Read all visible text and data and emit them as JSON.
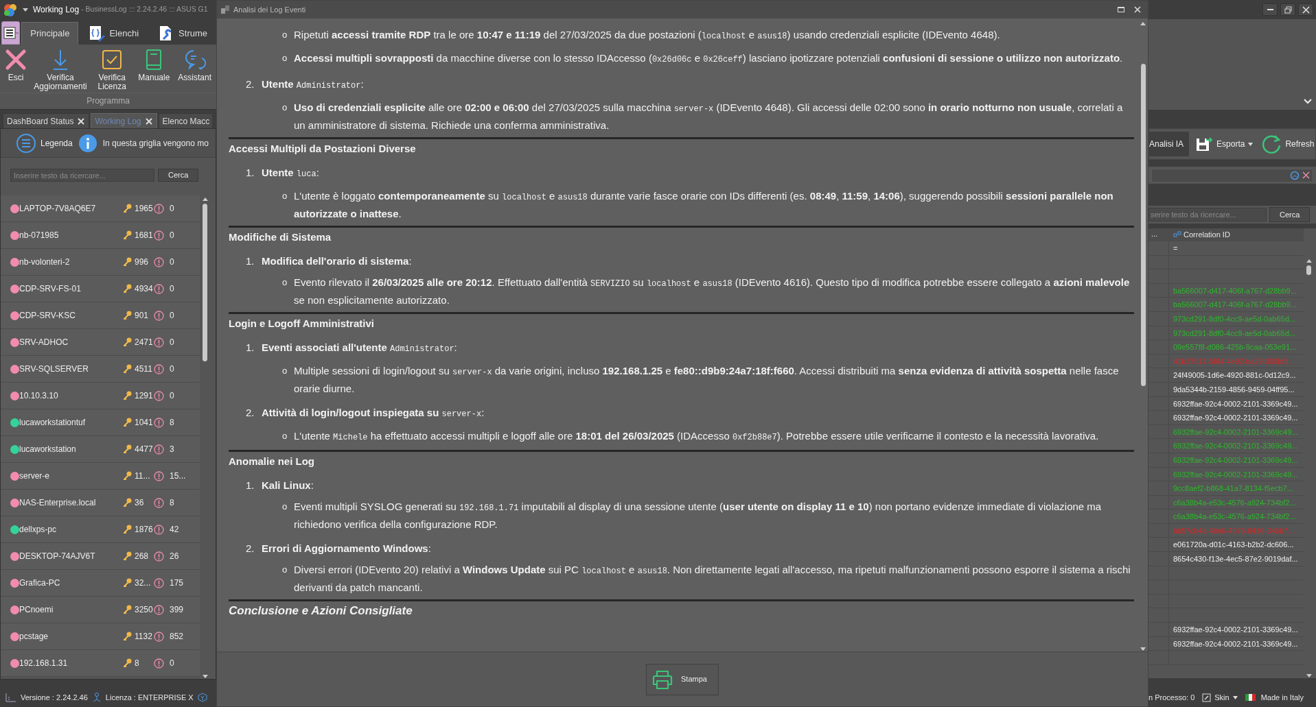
{
  "app": {
    "title": "Working Log",
    "subtitle": "- BusinessLog ::: 2.24.2.46 ::: ASUS G1"
  },
  "ribbon_tabs": [
    {
      "label": "Principale",
      "selected": true
    },
    {
      "label": "Elenchi",
      "selected": false
    },
    {
      "label": "Strume",
      "selected": false
    }
  ],
  "ribbon_group": {
    "label": "Programma",
    "buttons": [
      {
        "label": "Esci"
      },
      {
        "label": "Verifica Aggiornamenti"
      },
      {
        "label": "Verifica Licenza"
      },
      {
        "label": "Manuale"
      },
      {
        "label": "Assistant"
      }
    ]
  },
  "doc_tabs": [
    {
      "label": "DashBoard Status",
      "selected": false,
      "closable": true
    },
    {
      "label": "Working Log",
      "selected": true,
      "closable": true
    },
    {
      "label": "Elenco Macc",
      "selected": false,
      "closable": false
    }
  ],
  "toolbar": {
    "legend": "Legenda",
    "info": "In questa griglia vengono mo"
  },
  "search": {
    "placeholder": "Inserire testo da ricercare...",
    "button": "Cerca"
  },
  "machines": [
    {
      "name": "LAPTOP-7V8AQ6E7",
      "color": "#f28cae",
      "keys": "1965",
      "alerts": "0"
    },
    {
      "name": "nb-071985",
      "color": "#f28cae",
      "keys": "1681",
      "alerts": "0"
    },
    {
      "name": "nb-volonteri-2",
      "color": "#f28cae",
      "keys": "996",
      "alerts": "0"
    },
    {
      "name": "CDP-SRV-FS-01",
      "color": "#f28cae",
      "keys": "4934",
      "alerts": "0"
    },
    {
      "name": "CDP-SRV-KSC",
      "color": "#f28cae",
      "keys": "901",
      "alerts": "0"
    },
    {
      "name": "SRV-ADHOC",
      "color": "#f28cae",
      "keys": "2471",
      "alerts": "0"
    },
    {
      "name": "SRV-SQLSERVER",
      "color": "#f28cae",
      "keys": "4511",
      "alerts": "0"
    },
    {
      "name": "10.10.3.10",
      "color": "#f28cae",
      "keys": "1291",
      "alerts": "0"
    },
    {
      "name": "lucaworkstationtuf",
      "color": "#34d399",
      "keys": "1041",
      "alerts": "8"
    },
    {
      "name": "lucaworkstation",
      "color": "#34d399",
      "keys": "4477",
      "alerts": "3"
    },
    {
      "name": "server-e",
      "color": "#f28cae",
      "keys": "11...",
      "alerts": "15..."
    },
    {
      "name": "NAS-Enterprise.local",
      "color": "#f28cae",
      "keys": "36",
      "alerts": "8"
    },
    {
      "name": "dellxps-pc",
      "color": "#34d399",
      "keys": "1876",
      "alerts": "42"
    },
    {
      "name": "DESKTOP-74AJV6T",
      "color": "#f28cae",
      "keys": "268",
      "alerts": "26"
    },
    {
      "name": "Grafica-PC",
      "color": "#f28cae",
      "keys": "32...",
      "alerts": "175"
    },
    {
      "name": "PCnoemi",
      "color": "#f28cae",
      "keys": "3250",
      "alerts": "399"
    },
    {
      "name": "pcstage",
      "color": "#f28cae",
      "keys": "1132",
      "alerts": "852"
    },
    {
      "name": "192.168.1.31",
      "color": "#f28cae",
      "keys": "8",
      "alerts": "0"
    }
  ],
  "status_left": [
    "Versione : 2.24.2.46",
    "Licenza : ENTERPRISE X"
  ],
  "dialog": {
    "title": "Analisi dei Log Eventi",
    "print_button": "Stampa",
    "blocks": [
      {
        "kind": "bullet",
        "marker": "o",
        "segments": [
          {
            "kind": "text",
            "text": "Ripetuti **accessi tramite RDP** tra le ore **10:47 e 11:19** del 27/03/2025 da due postazioni ("
          },
          {
            "kind": "code",
            "text": "localhost"
          },
          {
            "kind": "text",
            "text": " e "
          },
          {
            "kind": "code",
            "text": "asus18"
          },
          {
            "kind": "text",
            "text": ") usando credenziali esplicite (IDEvento 4648)."
          }
        ]
      },
      {
        "kind": "bullet",
        "marker": "o",
        "segments": [
          {
            "kind": "text",
            "text": "**Accessi multipli sovrapposti** da macchine diverse con lo stesso IDAccesso ("
          },
          {
            "kind": "code",
            "text": "0x26d06c"
          },
          {
            "kind": "text",
            "text": " e "
          },
          {
            "kind": "code",
            "text": "0x26ceff"
          },
          {
            "kind": "text",
            "text": ") lasciano ipotizzare potenziali **confusioni di sessione o utilizzo non autorizzato**."
          }
        ]
      },
      {
        "kind": "item",
        "marker": "2.",
        "segments": [
          {
            "kind": "text",
            "text": "**Utente** "
          },
          {
            "kind": "code",
            "text": "Administrator"
          },
          {
            "kind": "text",
            "text": ":"
          }
        ]
      },
      {
        "kind": "bullet",
        "marker": "o",
        "segments": [
          {
            "kind": "text",
            "text": "**Uso di credenziali esplicite** alle ore **02:00 e 06:00** del 27/03/2025 sulla macchina "
          },
          {
            "kind": "code",
            "text": "server-x"
          },
          {
            "kind": "text",
            "text": " (IDEvento 4648). Gli accessi delle 02:00 sono **in orario notturno non usuale**, correlati a un amministratore di sistema. Richiede una conferma amministrativa."
          }
        ]
      },
      {
        "kind": "rule"
      },
      {
        "kind": "heading",
        "text": "Accessi Multipli da Postazioni Diverse"
      },
      {
        "kind": "item",
        "marker": "1.",
        "segments": [
          {
            "kind": "text",
            "text": "**Utente** "
          },
          {
            "kind": "code",
            "text": "luca"
          },
          {
            "kind": "text",
            "text": ":"
          }
        ]
      },
      {
        "kind": "bullet",
        "marker": "o",
        "segments": [
          {
            "kind": "text",
            "text": "L'utente è loggato **contemporaneamente** su "
          },
          {
            "kind": "code",
            "text": "localhost"
          },
          {
            "kind": "text",
            "text": " e "
          },
          {
            "kind": "code",
            "text": "asus18"
          },
          {
            "kind": "text",
            "text": " durante varie fasce orarie con IDs differenti (es. **08:49**, **11:59**, **14:06**), suggerendo possibili **sessioni parallele non autorizzate o inattese**."
          }
        ]
      },
      {
        "kind": "rule"
      },
      {
        "kind": "heading",
        "text": "Modifiche di Sistema"
      },
      {
        "kind": "item",
        "marker": "1.",
        "segments": [
          {
            "kind": "text",
            "text": "**Modifica dell'orario di sistema**:"
          }
        ]
      },
      {
        "kind": "bullet",
        "marker": "o",
        "segments": [
          {
            "kind": "text",
            "text": "Evento rilevato il **26/03/2025 alle ore 20:12**. Effettuato dall'entità "
          },
          {
            "kind": "code",
            "text": "SERVIZIO"
          },
          {
            "kind": "text",
            "text": " su "
          },
          {
            "kind": "code",
            "text": "localhost"
          },
          {
            "kind": "text",
            "text": " e "
          },
          {
            "kind": "code",
            "text": "asus18"
          },
          {
            "kind": "text",
            "text": " (IDEvento 4616). Questo tipo di modifica potrebbe essere collegato a **azioni malevole** se non esplicitamente autorizzato."
          }
        ]
      },
      {
        "kind": "rule"
      },
      {
        "kind": "heading",
        "text": "Login e Logoff Amministrativi"
      },
      {
        "kind": "item",
        "marker": "1.",
        "segments": [
          {
            "kind": "text",
            "text": "**Eventi associati all'utente** "
          },
          {
            "kind": "code",
            "text": "Administrator"
          },
          {
            "kind": "text",
            "text": ":"
          }
        ]
      },
      {
        "kind": "bullet",
        "marker": "o",
        "segments": [
          {
            "kind": "text",
            "text": "Multiple sessioni di login/logout su "
          },
          {
            "kind": "code",
            "text": "server-x"
          },
          {
            "kind": "text",
            "text": " da varie origini, incluso **192.168.1.25** e **fe80::d9b9:24a7:18f:f660**. Accessi distribuiti ma **senza evidenza di attività sospetta** nelle fasce orarie diurne."
          }
        ]
      },
      {
        "kind": "item",
        "marker": "2.",
        "segments": [
          {
            "kind": "text",
            "text": "**Attività di login/logout inspiegata su** "
          },
          {
            "kind": "code",
            "text": "server-x"
          },
          {
            "kind": "text",
            "text": ":"
          }
        ]
      },
      {
        "kind": "bullet",
        "marker": "o",
        "segments": [
          {
            "kind": "text",
            "text": "L'utente "
          },
          {
            "kind": "code",
            "text": "Michele"
          },
          {
            "kind": "text",
            "text": " ha effettuato accessi multipli e logoff alle ore **18:01 del 26/03/2025** (IDAccesso "
          },
          {
            "kind": "code",
            "text": "0xf2b88e7"
          },
          {
            "kind": "text",
            "text": "). Potrebbe essere utile verificarne il contesto e la necessità lavorativa."
          }
        ]
      },
      {
        "kind": "rule"
      },
      {
        "kind": "heading",
        "text": "Anomalie nei Log"
      },
      {
        "kind": "item",
        "marker": "1.",
        "segments": [
          {
            "kind": "text",
            "text": "**Kali Linux**:"
          }
        ]
      },
      {
        "kind": "bullet",
        "marker": "o",
        "segments": [
          {
            "kind": "text",
            "text": "Eventi multipli SYSLOG generati su "
          },
          {
            "kind": "code",
            "text": "192.168.1.71"
          },
          {
            "kind": "text",
            "text": " imputabili al display di una sessione utente (**user utente on display 11 e 10**) non portano evidenze immediate di violazione ma richiedono verifica della configurazione RDP."
          }
        ]
      },
      {
        "kind": "item",
        "marker": "2.",
        "segments": [
          {
            "kind": "text",
            "text": "**Errori di Aggiornamento Windows**:"
          }
        ]
      },
      {
        "kind": "bullet",
        "marker": "o",
        "segments": [
          {
            "kind": "text",
            "text": "Diversi errori (IDEvento 20) relativi a **Windows Update** sui PC "
          },
          {
            "kind": "code",
            "text": "localhost"
          },
          {
            "kind": "text",
            "text": " e "
          },
          {
            "kind": "code",
            "text": "asus18"
          },
          {
            "kind": "text",
            "text": ". Non direttamente legati all'accesso, ma ripetuti malfunzionamenti possono esporre il sistema a rischi derivanti da patch mancanti."
          }
        ]
      },
      {
        "kind": "rule"
      },
      {
        "kind": "conclusion",
        "text": "Conclusione e Azioni Consigliate"
      }
    ]
  },
  "right": {
    "buttons": [
      {
        "label": "Analisi IA"
      },
      {
        "label": "Esporta"
      },
      {
        "label": "Refresh"
      }
    ],
    "search": {
      "placeholder": "serire testo da ricercare...",
      "button": "Cerca"
    },
    "columns": [
      "...",
      "Correlation ID"
    ],
    "filter": "=",
    "rows": [
      {
        "kind": "blank"
      },
      {
        "kind": "blank"
      },
      {
        "kind": "id",
        "text": "ba566007-d417-406f-a767-d28bb9...",
        "color": "#2db82d"
      },
      {
        "kind": "id",
        "text": "ba566007-d417-406f-a767-d28bb9...",
        "color": "#2db82d"
      },
      {
        "kind": "id",
        "text": "973cd291-8df0-4cc9-ae5d-0ab65d...",
        "color": "#2db82d"
      },
      {
        "kind": "id",
        "text": "973cd291-8df0-4cc9-ae5d-0ab65d...",
        "color": "#2db82d"
      },
      {
        "kind": "id",
        "text": "09e557f8-d086-425b-9caa-053e91...",
        "color": "#2db82d"
      },
      {
        "kind": "id",
        "text": "41b37517-5f84-4e92-ba29-050bf3...",
        "color": "#d42a2a"
      },
      {
        "kind": "id",
        "text": "24f49005-1d6e-4920-881c-0d12c9...",
        "color": "#f0f0f0"
      },
      {
        "kind": "id",
        "text": "9da5344b-2159-4856-9459-04ff95...",
        "color": "#f0f0f0"
      },
      {
        "kind": "id",
        "text": "6932ffae-92c4-0002-2101-3369c49...",
        "color": "#f0f0f0"
      },
      {
        "kind": "id",
        "text": "6932ffae-92c4-0002-2101-3369c49...",
        "color": "#f0f0f0"
      },
      {
        "kind": "id",
        "text": "6932ffae-92c4-0002-2101-3369c49...",
        "color": "#2db82d"
      },
      {
        "kind": "id",
        "text": "6932ffae-92c4-0002-2101-3369c49...",
        "color": "#2db82d"
      },
      {
        "kind": "id",
        "text": "6932ffae-92c4-0002-2101-3369c49...",
        "color": "#2db82d"
      },
      {
        "kind": "id",
        "text": "6932ffae-92c4-0002-2101-3369c49...",
        "color": "#2db82d"
      },
      {
        "kind": "id",
        "text": "9cc8aef2-b868-41a7-8134-f5ecb7...",
        "color": "#2db82d"
      },
      {
        "kind": "id",
        "text": "c6a38b4a-e53c-4576-a924-734bf2...",
        "color": "#2db82d"
      },
      {
        "kind": "id",
        "text": "c6a38b4a-e53c-4576-a924-734bf2...",
        "color": "#2db82d"
      },
      {
        "kind": "id",
        "text": "bb57cb4d-48e6-4976-8416-345b7...",
        "color": "#d42a2a"
      },
      {
        "kind": "id",
        "text": "e061720a-d01c-4163-b2b2-dc606...",
        "color": "#f0f0f0"
      },
      {
        "kind": "id",
        "text": "8654c430-f13e-4ec5-87e2-9019daf...",
        "color": "#f0f0f0"
      },
      {
        "kind": "blank"
      },
      {
        "kind": "blank"
      },
      {
        "kind": "blank"
      },
      {
        "kind": "blank"
      },
      {
        "kind": "id",
        "text": "6932ffae-92c4-0002-2101-3369c49...",
        "color": "#f0f0f0"
      },
      {
        "kind": "id",
        "text": "6932ffae-92c4-0002-2101-3369c49...",
        "color": "#f0f0f0"
      },
      {
        "kind": "blank"
      }
    ],
    "status": {
      "process": "n Processo: 0",
      "skin": "Skin",
      "made": "Made in Italy"
    }
  }
}
